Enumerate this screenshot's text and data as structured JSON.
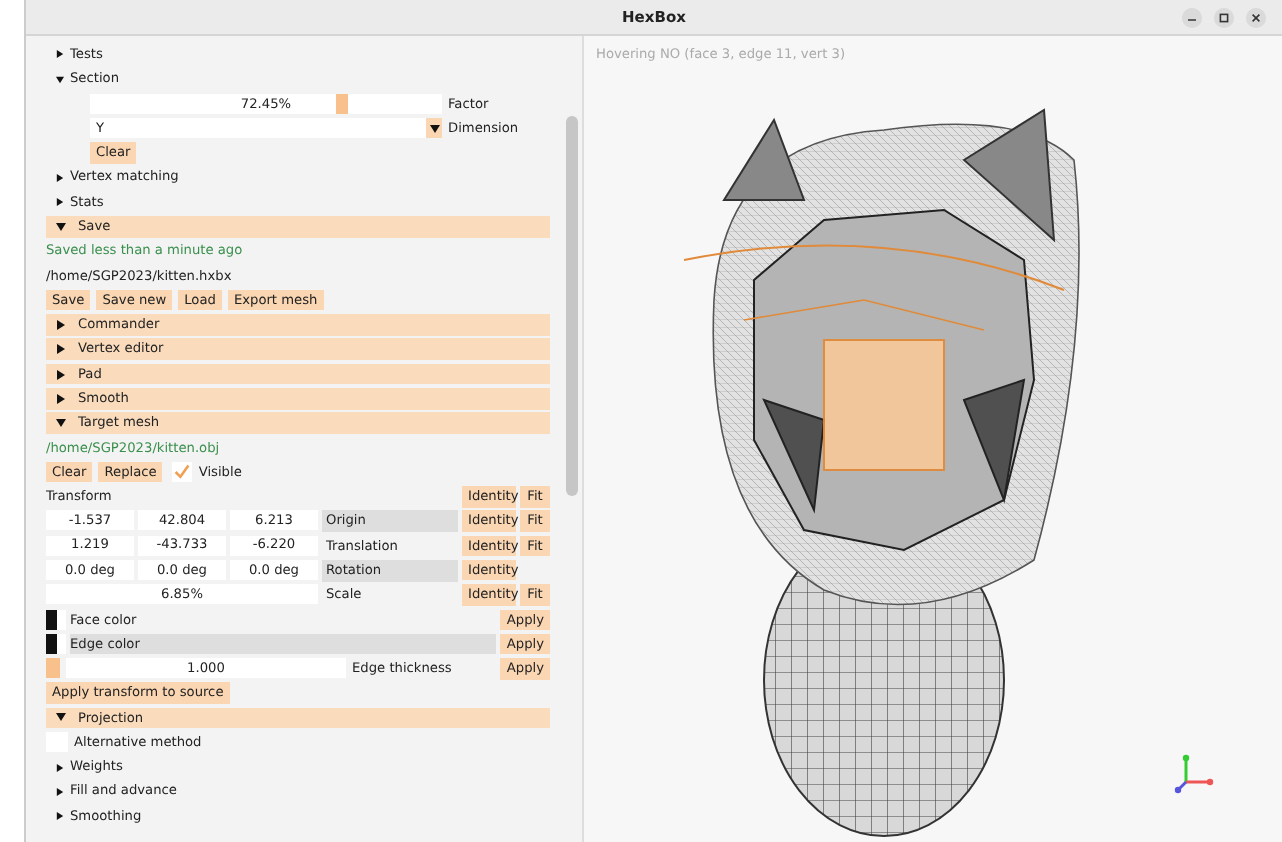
{
  "window": {
    "title": "HexBox"
  },
  "panel": [
    {
      "kind": "tree",
      "label": "Tests",
      "expanded": false
    },
    {
      "kind": "tree",
      "label": "Section",
      "expanded": true
    },
    {
      "kind": "slider",
      "value": "72.45%",
      "level": 0.7245,
      "label": "Factor"
    },
    {
      "kind": "dropdown",
      "label": "Dimension",
      "option": "Y"
    },
    {
      "kind": "buttons",
      "buttons": [
        "Clear"
      ]
    },
    {
      "kind": "tree",
      "label": "Vertex matching",
      "expanded": false
    },
    {
      "kind": "tree",
      "label": "Stats",
      "expanded": false
    },
    {
      "kind": "header",
      "label": "Save",
      "expanded": true
    },
    {
      "kind": "status",
      "text": "Saved less than a minute ago"
    },
    {
      "kind": "text",
      "text": "/home/SGP2023/kitten.hxbx"
    },
    {
      "kind": "buttons",
      "buttons": [
        "Save",
        "Save new",
        "Load",
        "Export mesh"
      ]
    },
    {
      "kind": "header",
      "label": "Commander",
      "expanded": false
    },
    {
      "kind": "header",
      "label": "Vertex editor",
      "expanded": false
    },
    {
      "kind": "header",
      "label": "Pad",
      "expanded": false
    },
    {
      "kind": "header",
      "label": "Smooth",
      "expanded": false
    },
    {
      "kind": "header",
      "label": "Target mesh",
      "expanded": true
    },
    {
      "kind": "status",
      "text": "/home/SGP2023/kitten.obj"
    },
    {
      "kind": "buttons",
      "buttons": [
        "Clear",
        "Replace"
      ],
      "checkbox": {
        "label": "Visible",
        "checked": true
      }
    },
    {
      "kind": "grid",
      "label": "Transform",
      "buttons": [
        "Identity",
        "Fit"
      ],
      "shaded": false
    },
    {
      "kind": "grid",
      "cells": [
        "-1.537",
        "42.804",
        "6.213"
      ],
      "label": "Origin",
      "buttons": [
        "Identity",
        "Fit"
      ],
      "shaded": true
    },
    {
      "kind": "grid",
      "cells": [
        "1.219",
        "-43.733",
        "-6.220"
      ],
      "label": "Translation",
      "buttons": [
        "Identity",
        "Fit"
      ],
      "shaded": false
    },
    {
      "kind": "grid",
      "cells": [
        "0.0 deg",
        "0.0 deg",
        "0.0 deg"
      ],
      "label": "Rotation",
      "buttons": [
        "Identity"
      ],
      "shaded": true
    },
    {
      "kind": "grid",
      "cells": [
        "6.85%"
      ],
      "label": "Scale",
      "buttons": [
        "Identity",
        "Fit"
      ],
      "shaded": false
    },
    {
      "kind": "color",
      "label": "Face color",
      "button": "Apply",
      "shaded": false
    },
    {
      "kind": "color",
      "label": "Edge color",
      "button": "Apply",
      "shaded": true
    },
    {
      "kind": "number",
      "value": "1.000",
      "label": "Edge thickness",
      "button": "Apply"
    },
    {
      "kind": "buttons",
      "buttons": [
        "Apply transform to source"
      ]
    },
    {
      "kind": "header",
      "label": "Projection",
      "expanded": true
    },
    {
      "kind": "checkbox",
      "label": "Alternative method",
      "checked": false
    },
    {
      "kind": "tree",
      "label": "Weights",
      "expanded": false
    },
    {
      "kind": "tree",
      "label": "Fill and advance",
      "expanded": false
    },
    {
      "kind": "tree",
      "label": "Smoothing",
      "expanded": false
    }
  ],
  "viewport": {
    "hover_text": "Hovering NO (face 3, edge 11, vert 3)"
  }
}
